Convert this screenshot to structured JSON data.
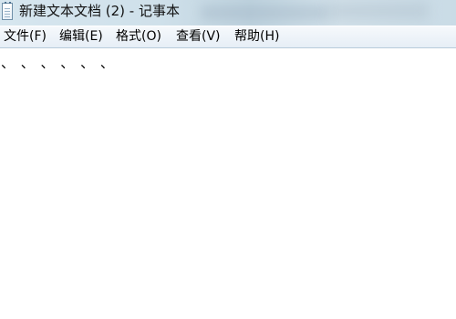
{
  "window": {
    "title": "新建文本文档 (2) - 记事本",
    "icon": "notepad-icon"
  },
  "menu": {
    "file": "文件(F)",
    "edit": "编辑(E)",
    "format": "格式(O)",
    "view": "查看(V)",
    "help": "帮助(H)"
  },
  "editor": {
    "content": "、 、 、 、 、 、"
  }
}
